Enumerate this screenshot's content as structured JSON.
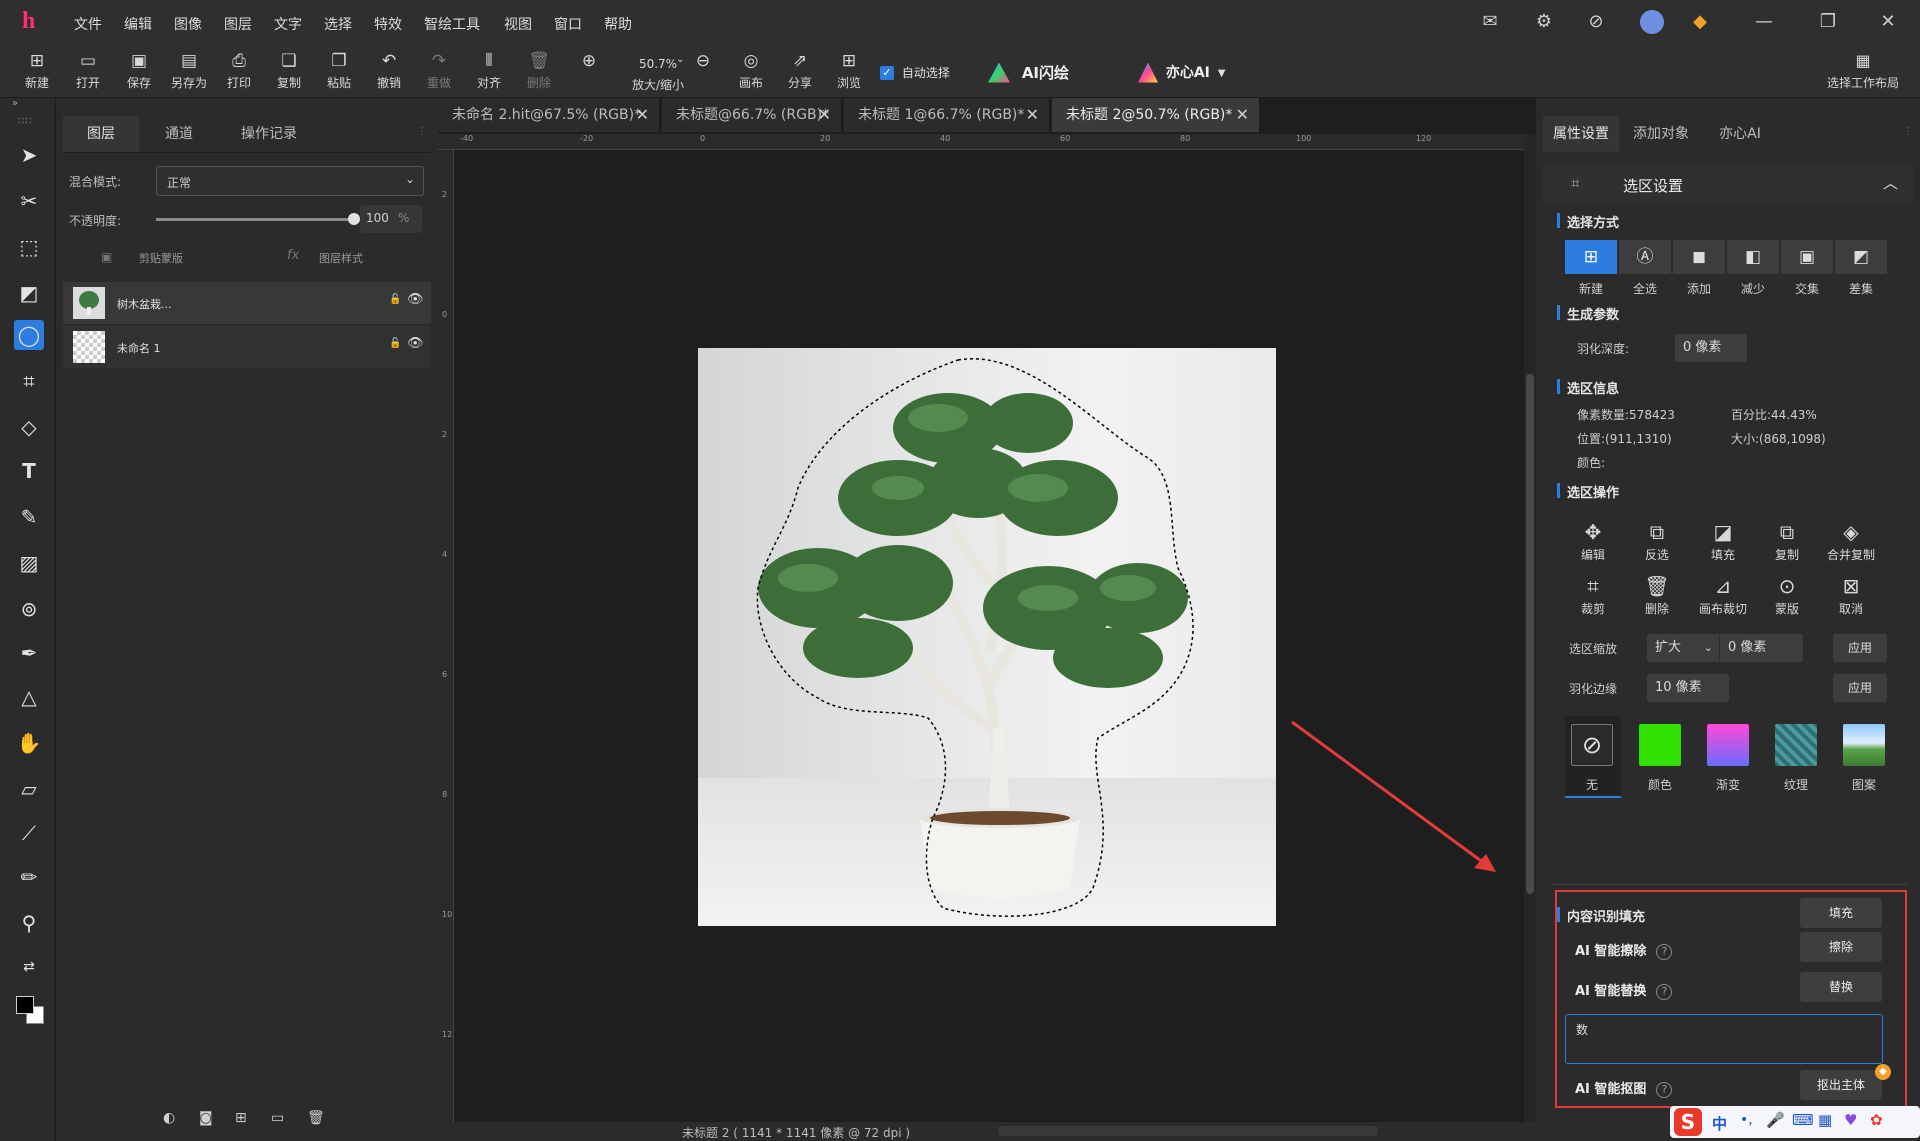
{
  "menubar": {
    "logo": "h",
    "items": [
      "文件",
      "编辑",
      "图像",
      "图层",
      "文字",
      "选择",
      "特效",
      "智绘工具",
      "视图",
      "窗口",
      "帮助"
    ]
  },
  "toolbar": {
    "buttons": [
      "新建",
      "打开",
      "保存",
      "另存为",
      "打印",
      "复制",
      "粘贴",
      "撤销",
      "重做",
      "对齐",
      "删除"
    ],
    "zoom_value": "50.7%",
    "zoom_label": "放大/缩小",
    "canvas": "画布",
    "share": "分享",
    "browse": "浏览",
    "auto_select": "自动选择",
    "ai_flash": "AI闪绘",
    "yixin_ai": "亦心AI",
    "workspace": "选择工作布局"
  },
  "layers_panel": {
    "tabs": [
      "图层",
      "通道",
      "操作记录"
    ],
    "blend_label": "混合模式:",
    "blend_value": "正常",
    "opacity_label": "不透明度:",
    "opacity_value": "100",
    "opacity_unit": "%",
    "opacity_fraction": 1.0,
    "clip_mask": "剪贴蒙版",
    "layer_style": "图层样式",
    "layers": [
      {
        "name": "树木盆栽..."
      },
      {
        "name": "未命名 1"
      }
    ]
  },
  "document": {
    "tabs": [
      {
        "title": "未命名 2.hit@67.5% (RGB)*"
      },
      {
        "title": "未标题@66.7% (RGB)*"
      },
      {
        "title": "未标题 1@66.7% (RGB)*"
      },
      {
        "title": "未标题 2@50.7% (RGB)*"
      }
    ],
    "ruler_h": [
      "-40",
      "-20",
      "0",
      "20",
      "40",
      "60",
      "80",
      "100",
      "120"
    ],
    "ruler_v": [
      "2",
      "0",
      "2",
      "4",
      "6",
      "8",
      "10",
      "12"
    ],
    "status": "未标题 2 ( 1141 * 1141 像素 @ 72 dpi )"
  },
  "right_panel": {
    "tabs": [
      "属性设置",
      "添加对象",
      "亦心AI"
    ],
    "section_title": "选区设置",
    "select_mode_title": "选择方式",
    "modes": [
      "新建",
      "全选",
      "添加",
      "减少",
      "交集",
      "差集"
    ],
    "gen_params_title": "生成参数",
    "feather_label": "羽化深度:",
    "feather_value": "0 像素",
    "info_title": "选区信息",
    "pixel_count": "像素数量:578423",
    "percent": "百分比:44.43%",
    "position": "位置:(911,1310)",
    "size": "大小:(868,1098)",
    "color_label": "颜色:",
    "ops_title": "选区操作",
    "ops_row1": [
      "编辑",
      "反选",
      "填充",
      "复制",
      "合并复制"
    ],
    "ops_row2": [
      "裁剪",
      "删除",
      "画布裁切",
      "蒙版",
      "取消"
    ],
    "scale_label": "选区缩放",
    "scale_mode": "扩大",
    "scale_value": "0 像素",
    "apply": "应用",
    "feather_edge_label": "羽化边缘",
    "feather_edge_value": "10 像素",
    "fill_options": [
      "无",
      "颜色",
      "渐变",
      "纹理",
      "图案"
    ],
    "swatch_color": "#32e000",
    "content_fill": "内容识别填充",
    "fill_btn": "填充",
    "ai_erase": "AI 智能擦除",
    "erase_btn": "擦除",
    "ai_replace": "AI 智能替换",
    "replace_btn": "替换",
    "prompt_value": "数",
    "ai_cutout": "AI 智能抠图",
    "cutout_btn": "抠出主体"
  },
  "ime": {
    "label": "中"
  }
}
